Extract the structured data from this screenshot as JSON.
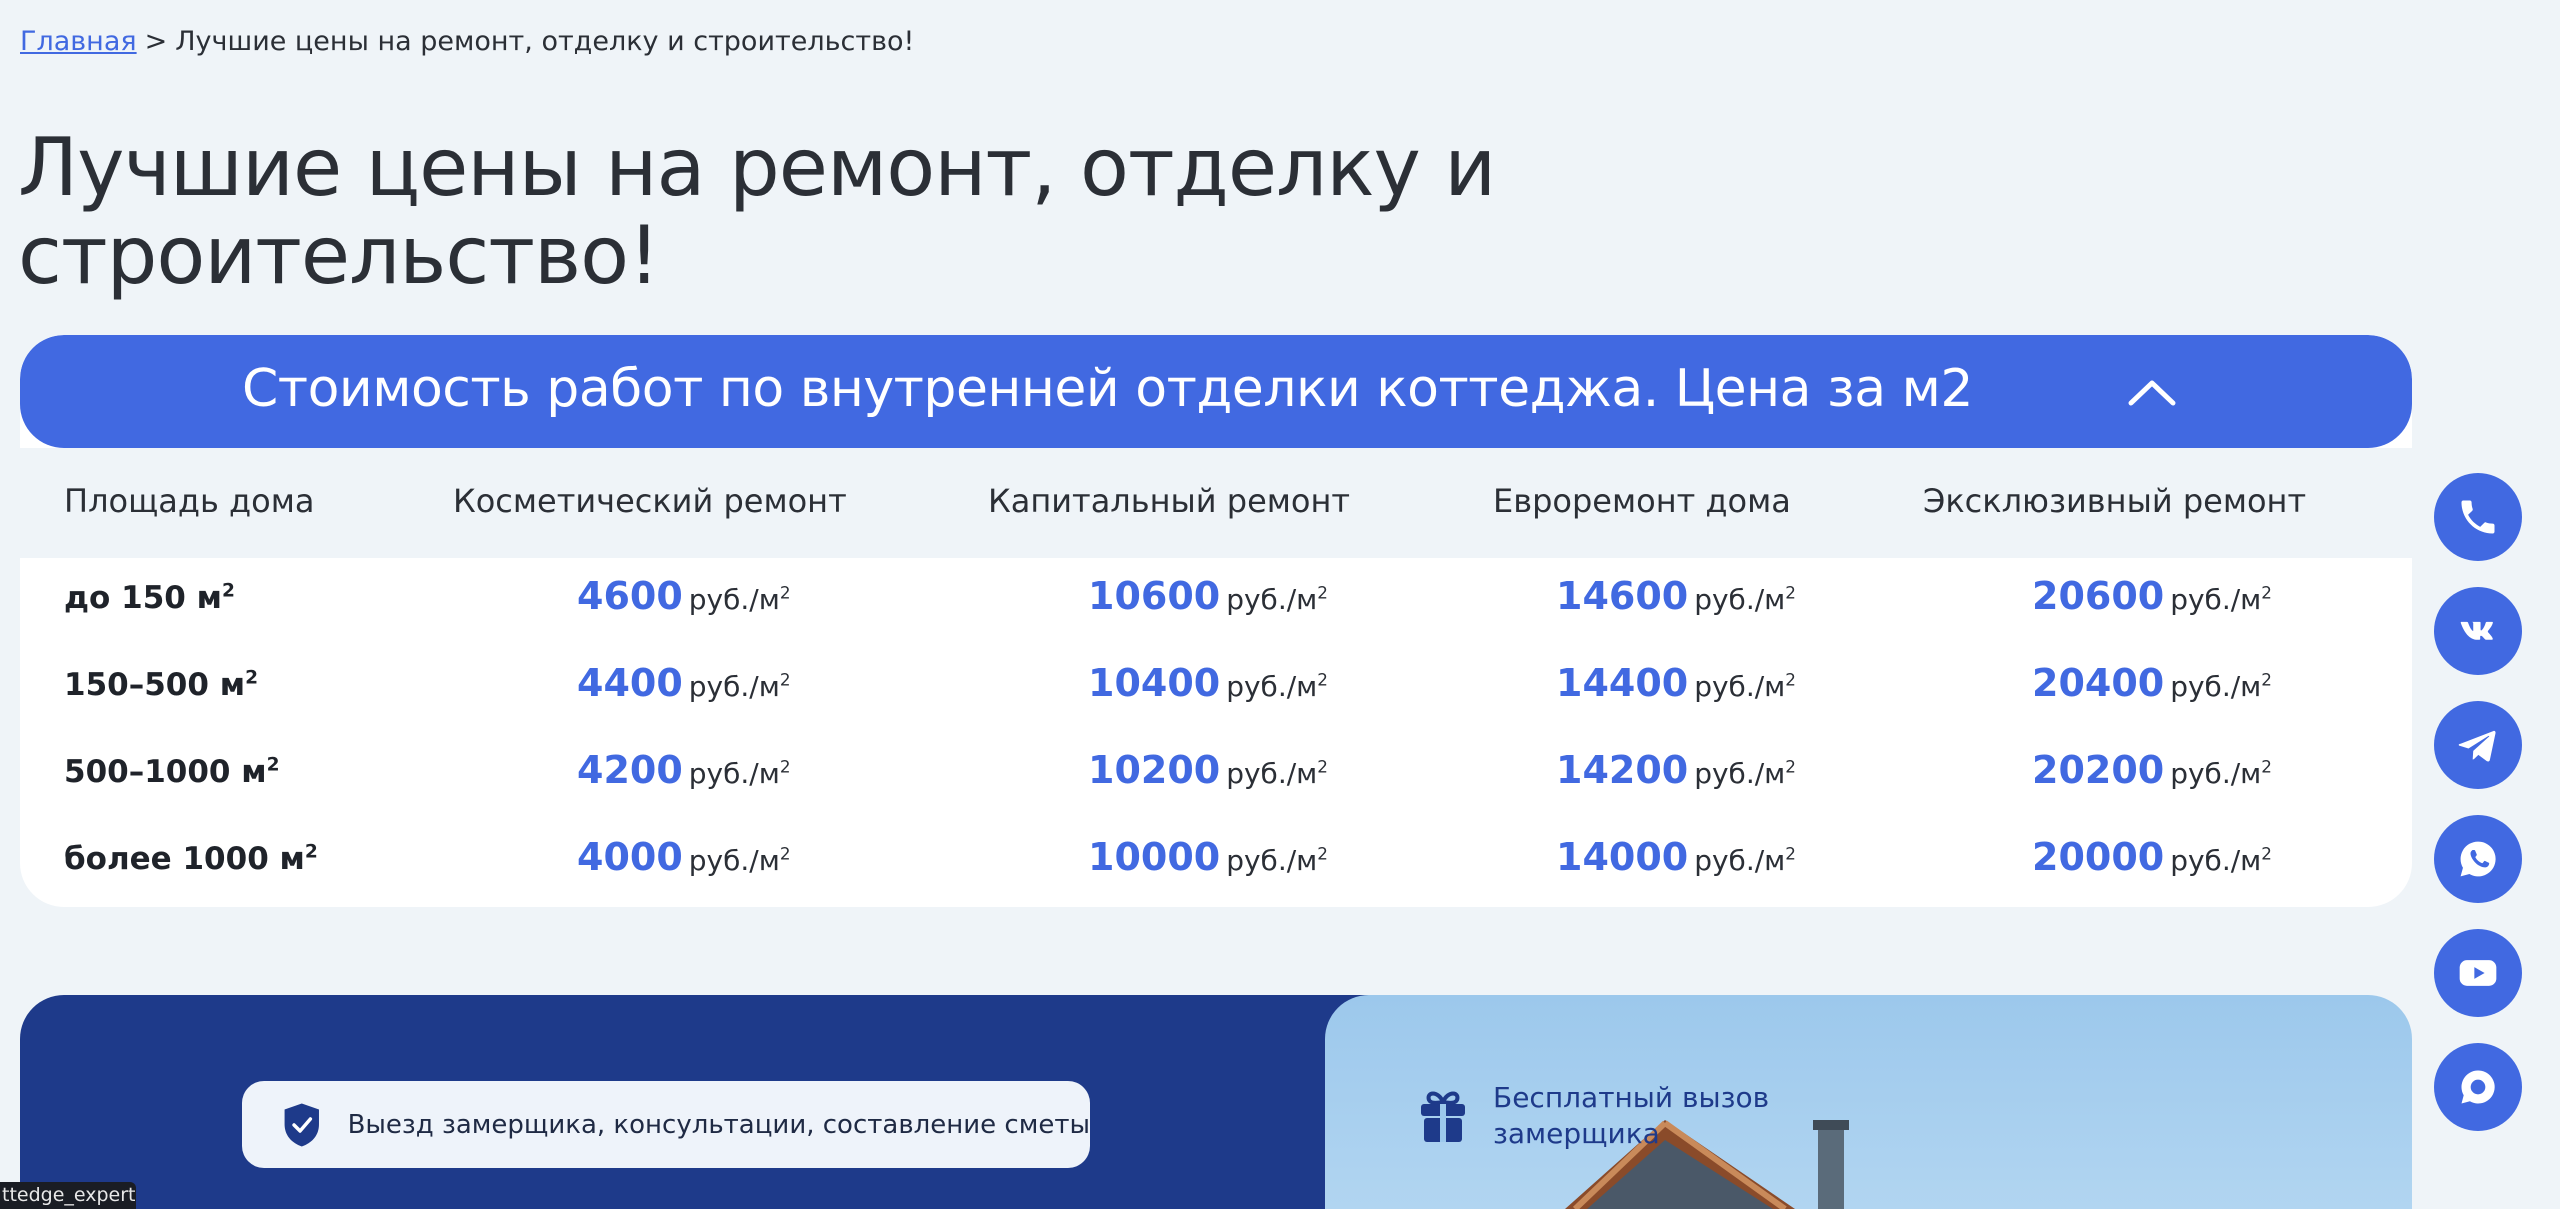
{
  "breadcrumb": {
    "home": "Главная",
    "separator": ">",
    "current": "Лучшие цены на ремонт, отделку и строительство!"
  },
  "page": {
    "title_line1": "Лучшие цены на ремонт, отделку и",
    "title_line2": "строительство!"
  },
  "price_card": {
    "title": "Стоимость работ по внутренней отделки коттеджа. Цена за м2",
    "columns": [
      "Площадь дома",
      "Косметический ремонт",
      "Капитальный ремонт",
      "Евроремонт дома",
      "Эксклюзивный ремонт"
    ],
    "unit": "руб./м",
    "unit_sup": "2",
    "area_sup": "2",
    "rows": [
      {
        "area": "до 150 м",
        "prices": [
          "4600",
          "10600",
          "14600",
          "20600"
        ]
      },
      {
        "area": "150–500 м",
        "prices": [
          "4400",
          "10400",
          "14400",
          "20400"
        ]
      },
      {
        "area": "500–1000 м",
        "prices": [
          "4200",
          "10200",
          "14200",
          "20200"
        ]
      },
      {
        "area": "более 1000 м",
        "prices": [
          "4000",
          "10000",
          "14000",
          "20000"
        ]
      }
    ]
  },
  "promo": {
    "chip_text": "Выезд замерщика, консультации, составление сметы",
    "gift_text": "Бесплатный вызов замерщика"
  },
  "socials": [
    "phone-icon",
    "vk-icon",
    "telegram-icon",
    "whatsapp-icon",
    "youtube-icon",
    "chat-icon"
  ],
  "user_tag": "ttedge_expert",
  "colors": {
    "accent": "#4169e1",
    "dark_blue": "#1e3a8a",
    "background": "#eff4f8",
    "text": "#2b2f36"
  }
}
